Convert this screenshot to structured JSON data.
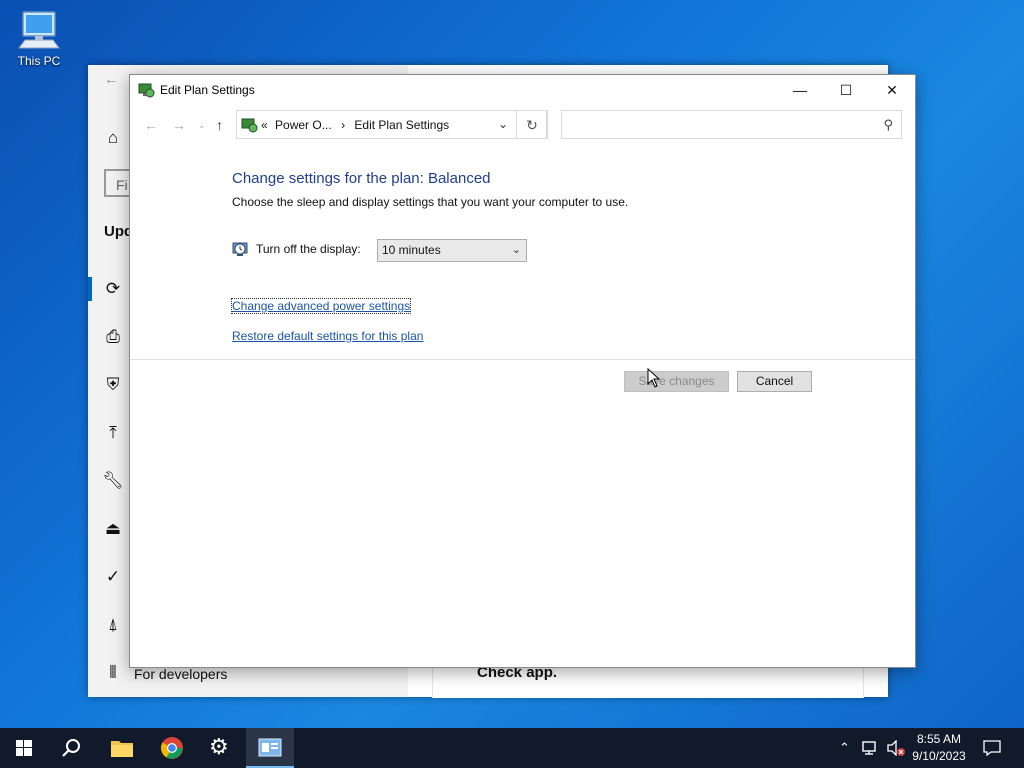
{
  "desktop": {
    "icon_label": "This PC"
  },
  "settings_window": {
    "search_partial": "Fi",
    "section_title_partial": "Upd",
    "sidebar_bottom_label": "For developers",
    "card_title": "Check app.",
    "icons": [
      "home-icon",
      "sync-icon",
      "delivery-icon",
      "shield-icon",
      "backup-icon",
      "wrench-icon",
      "recovery-icon",
      "activation-icon",
      "find-device-icon",
      "developer-icon"
    ]
  },
  "window": {
    "title": "Edit Plan Settings",
    "buttons": {
      "minimize": "—",
      "maximize": "☐",
      "close": "✕"
    }
  },
  "nav": {
    "breadcrumb_prefix": "«",
    "breadcrumb_parent": "Power O...",
    "breadcrumb_sep": "›",
    "breadcrumb_current": "Edit Plan Settings",
    "search_placeholder": ""
  },
  "content": {
    "heading": "Change settings for the plan: Balanced",
    "description": "Choose the sleep and display settings that you want your computer to use.",
    "display_label": "Turn off the display:",
    "display_value": "10 minutes",
    "link_advanced": "Change advanced power settings",
    "link_restore": "Restore default settings for this plan",
    "save_label": "Save changes",
    "cancel_label": "Cancel"
  },
  "taskbar": {
    "time": "8:55 AM",
    "date": "9/10/2023",
    "items": [
      "start-icon",
      "search-icon",
      "file-explorer-icon",
      "chrome-icon",
      "settings-icon",
      "control-panel-icon"
    ]
  },
  "colors": {
    "heading": "#1f3f8f",
    "link": "#1a55a8",
    "taskbar": "#101a2a",
    "accent": "#0067c0"
  }
}
